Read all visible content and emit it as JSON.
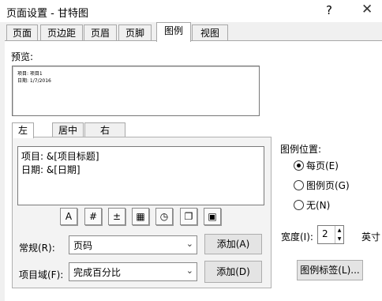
{
  "window": {
    "title": "页面设置 - 甘特图",
    "help": "?",
    "close": "✕"
  },
  "tabs": [
    "页面",
    "页边距",
    "页眉",
    "页脚",
    "图例",
    "视图"
  ],
  "preview": {
    "label": "预览:",
    "line1": "项目: 项目1",
    "line2": "日期: 1/7/2016"
  },
  "align_tabs": [
    "左",
    "居中",
    "右"
  ],
  "text": {
    "line1": "项目: &[项目标题]",
    "line2": "日期: &[日期]"
  },
  "toolbar_icons": [
    "format-font-icon",
    "page-number-icon",
    "page-count-icon",
    "date-icon",
    "time-icon",
    "file-name-icon",
    "insert-picture-icon"
  ],
  "toolbar_glyphs": [
    "A",
    "#",
    "±",
    "▦",
    "◷",
    "❐",
    "▣"
  ],
  "general": {
    "label": "常规(R):",
    "value": "页码",
    "add": "添加(A)"
  },
  "project_field": {
    "label": "项目域(F):",
    "value": "完成百分比",
    "add": "添加(D)"
  },
  "legend_position": {
    "label": "图例位置:",
    "options": [
      {
        "label": "每页(E)",
        "selected": true
      },
      {
        "label": "图例页(G)",
        "selected": false
      },
      {
        "label": "无(N)",
        "selected": false
      }
    ]
  },
  "width": {
    "label": "宽度(I):",
    "value": "2",
    "unit": "英寸"
  },
  "legend_labels_button": "图例标签(L)..."
}
